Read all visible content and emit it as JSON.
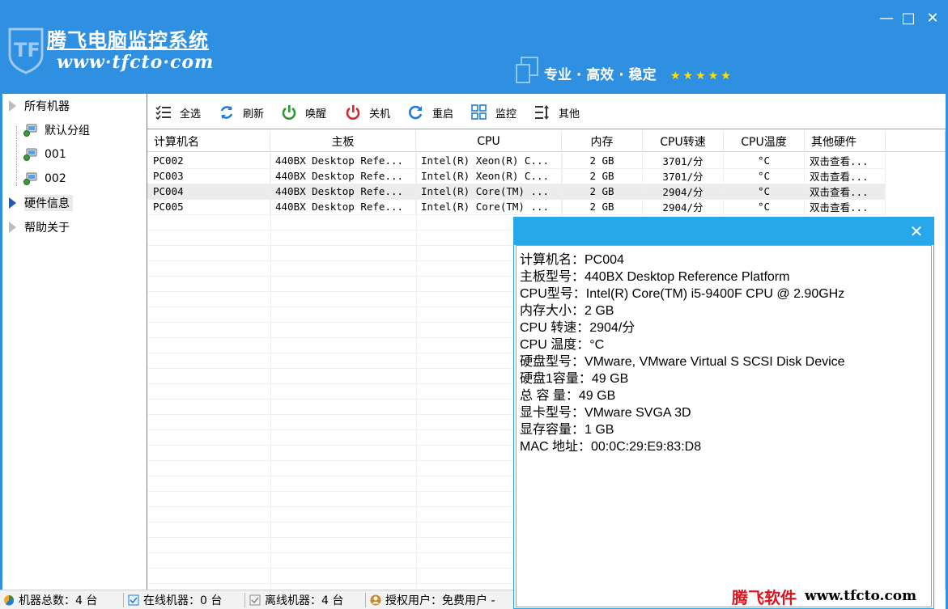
{
  "window": {
    "title": "腾飞电脑监控系统",
    "url": "www·tfcto·com",
    "slogan": "专业 · 高效 · 稳定",
    "stars": "★★★★★",
    "min_label": "—",
    "max_label": "□",
    "close_label": "✕"
  },
  "tree": {
    "root_all": "所有机器",
    "children": [
      "默认分组",
      "001",
      "002"
    ],
    "hardware": "硬件信息",
    "help": "帮助关于"
  },
  "toolbar": {
    "select_all": "全选",
    "refresh": "刷新",
    "wake": "唤醒",
    "shutdown": "关机",
    "restart": "重启",
    "monitor": "监控",
    "other": "其他"
  },
  "table": {
    "columns": [
      "计算机名",
      "主板",
      "CPU",
      "内存",
      "CPU转速",
      "CPU温度",
      "其他硬件"
    ],
    "rows": [
      [
        "PC002",
        "440BX Desktop Refe...",
        "Intel(R) Xeon(R) C...",
        "2 GB",
        "3701/分",
        "°C",
        "双击查看..."
      ],
      [
        "PC003",
        "440BX Desktop Refe...",
        "Intel(R) Xeon(R) C...",
        "2 GB",
        "3701/分",
        "°C",
        "双击查看..."
      ],
      [
        "PC004",
        "440BX Desktop Refe...",
        "Intel(R) Core(TM) ...",
        "2 GB",
        "2904/分",
        "°C",
        "双击查看..."
      ],
      [
        "PC005",
        "440BX Desktop Refe...",
        "Intel(R) Core(TM) ...",
        "2 GB",
        "2904/分",
        "°C",
        "双击查看..."
      ]
    ],
    "selected_row": 2
  },
  "popup": {
    "close_label": "✕",
    "lines": [
      "计算机名：PC004",
      "主板型号：440BX Desktop Reference Platform",
      "CPU型号：Intel(R) Core(TM) i5-9400F CPU @ 2.90GHz",
      "内存大小：2 GB",
      "CPU 转速：2904/分",
      "CPU 温度：°C",
      "硬盘型号：VMware, VMware Virtual S SCSI Disk Device",
      "硬盘1容量：49 GB",
      "总 容 量：49 GB",
      "显卡型号：VMware SVGA 3D",
      "显存容量：1 GB",
      "MAC 地址：00:0C:29:E9:83:D8"
    ]
  },
  "status": {
    "total": "机器总数：4 台",
    "online": "在线机器：0 台",
    "offline": "离线机器：4 台",
    "license": "授权用户：免费用户 -"
  },
  "brand": {
    "name": "腾飞软件",
    "url": "www.tfcto.com"
  },
  "colors": {
    "header": "#2f8fe0",
    "popup_bar": "#27a8ea",
    "brand_red": "#e0141e",
    "stars": "#ffe100"
  }
}
